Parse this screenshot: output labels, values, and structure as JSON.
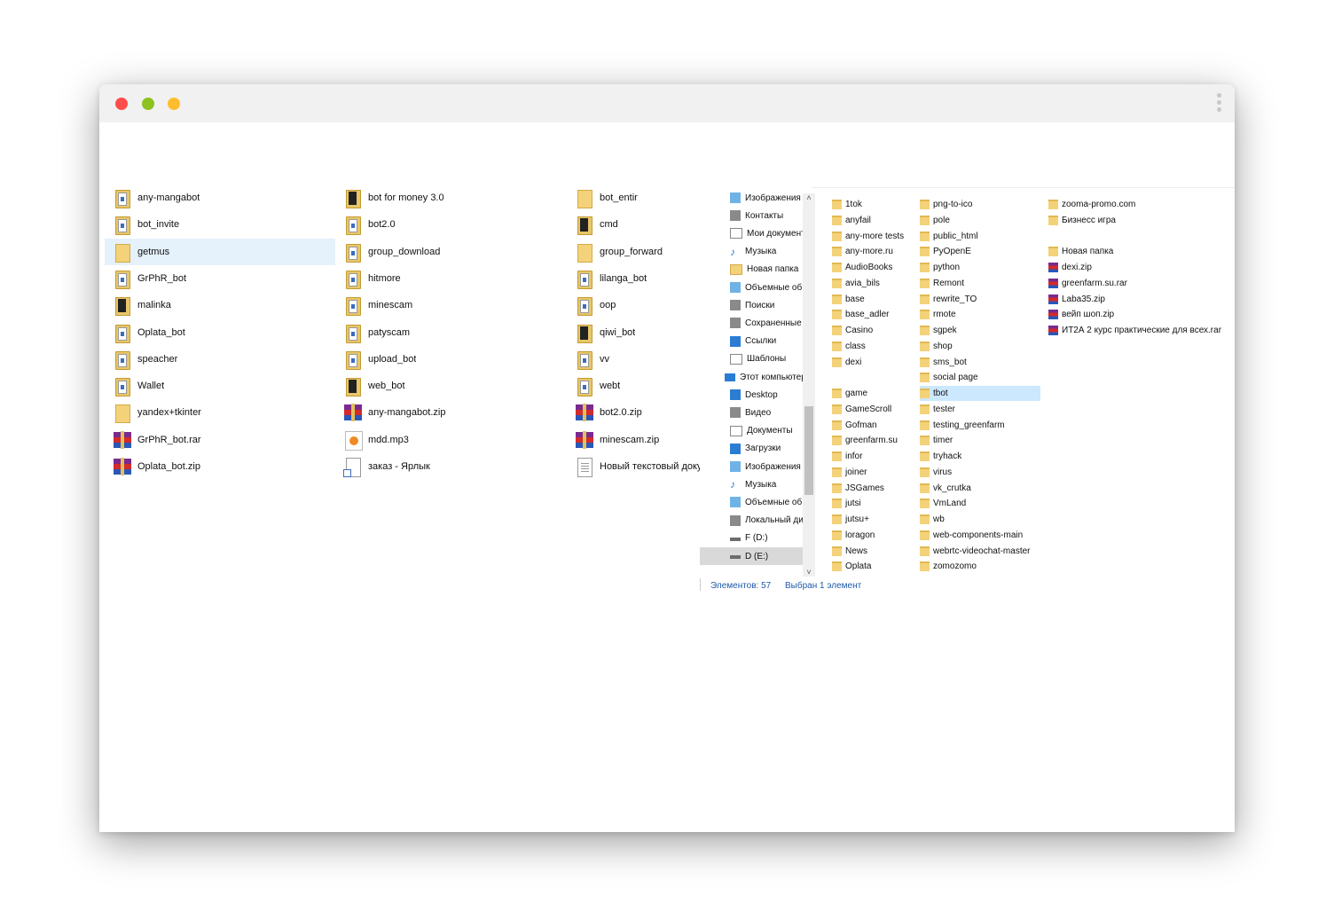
{
  "window": {
    "controls": [
      "close",
      "minimize",
      "maximize"
    ]
  },
  "left_view": {
    "columns": [
      [
        {
          "name": "any-mangabot",
          "icon": "folder-doc-icon"
        },
        {
          "name": "bot_invite",
          "icon": "folder-doc-icon"
        },
        {
          "name": "getmus",
          "icon": "folder-icon",
          "selected": true
        },
        {
          "name": "GrPhR_bot",
          "icon": "folder-doc-icon"
        },
        {
          "name": "malinka",
          "icon": "folder-dark-icon"
        },
        {
          "name": "Oplata_bot",
          "icon": "folder-doc-icon"
        },
        {
          "name": "speacher",
          "icon": "folder-doc-icon"
        },
        {
          "name": "Wallet",
          "icon": "folder-doc-icon"
        },
        {
          "name": "yandex+tkinter",
          "icon": "folder-icon"
        },
        {
          "name": "GrPhR_bot.rar",
          "icon": "archive-icon"
        },
        {
          "name": "Oplata_bot.zip",
          "icon": "archive-icon"
        }
      ],
      [
        {
          "name": "bot for money 3.0",
          "icon": "folder-dark-icon"
        },
        {
          "name": "bot2.0",
          "icon": "folder-doc-icon"
        },
        {
          "name": "group_download",
          "icon": "folder-doc-icon"
        },
        {
          "name": "hitmore",
          "icon": "folder-doc-icon"
        },
        {
          "name": "minescam",
          "icon": "folder-doc-icon"
        },
        {
          "name": "patyscam",
          "icon": "folder-doc-icon"
        },
        {
          "name": "upload_bot",
          "icon": "folder-doc-icon"
        },
        {
          "name": "web_bot",
          "icon": "folder-dark-icon"
        },
        {
          "name": "any-mangabot.zip",
          "icon": "archive-icon"
        },
        {
          "name": "mdd.mp3",
          "icon": "audio-icon"
        },
        {
          "name": "заказ - Ярлык",
          "icon": "shortcut-icon"
        }
      ],
      [
        {
          "name": "bot_entir",
          "icon": "folder-icon"
        },
        {
          "name": "cmd",
          "icon": "folder-dark-icon"
        },
        {
          "name": "group_forward",
          "icon": "folder-icon"
        },
        {
          "name": "lilanga_bot",
          "icon": "folder-doc-icon"
        },
        {
          "name": "oop",
          "icon": "folder-doc-icon"
        },
        {
          "name": "qiwi_bot",
          "icon": "folder-dark-icon"
        },
        {
          "name": "vv",
          "icon": "folder-doc-icon"
        },
        {
          "name": "webt",
          "icon": "folder-doc-icon"
        },
        {
          "name": "bot2.0.zip",
          "icon": "archive-icon"
        },
        {
          "name": "minescam.zip",
          "icon": "archive-icon"
        },
        {
          "name": "Новый текстовый докуме",
          "icon": "text-file-icon"
        }
      ]
    ]
  },
  "nav_pane": {
    "items": [
      {
        "label": "Изображения",
        "icon": "pictures-icon"
      },
      {
        "label": "Контакты",
        "icon": "contacts-icon"
      },
      {
        "label": "Мои документ",
        "icon": "documents-icon"
      },
      {
        "label": "Музыка",
        "icon": "music-icon"
      },
      {
        "label": "Новая папка",
        "icon": "folder-icon"
      },
      {
        "label": "Объемные об",
        "icon": "3d-objects-icon"
      },
      {
        "label": "Поиски",
        "icon": "search-icon"
      },
      {
        "label": "Сохраненные",
        "icon": "saved-games-icon"
      },
      {
        "label": "Ссылки",
        "icon": "links-icon"
      },
      {
        "label": "Шаблоны",
        "icon": "templates-icon"
      },
      {
        "label": "Этот компьютер",
        "icon": "this-pc-icon"
      },
      {
        "label": "Desktop",
        "icon": "desktop-icon"
      },
      {
        "label": "Видео",
        "icon": "video-icon"
      },
      {
        "label": "Документы",
        "icon": "documents-icon"
      },
      {
        "label": "Загрузки",
        "icon": "downloads-icon"
      },
      {
        "label": "Изображения",
        "icon": "pictures-icon"
      },
      {
        "label": "Музыка",
        "icon": "music-icon"
      },
      {
        "label": "Объемные об",
        "icon": "3d-objects-icon"
      },
      {
        "label": "Локальный ди",
        "icon": "local-disk-icon"
      },
      {
        "label": "F (D:)",
        "icon": "drive-icon"
      },
      {
        "label": "D (E:)",
        "icon": "drive-icon",
        "selected": true
      }
    ],
    "scroll_up": "˄",
    "scroll_down": "˅"
  },
  "file_grid": {
    "columns": [
      [
        "1tok",
        "anyfail",
        "any-more tests",
        "any-more.ru",
        "AudioBooks",
        "avia_bils",
        "base",
        "base_adler",
        "Casino",
        "class",
        "dexi",
        "",
        "game",
        "GameScroll",
        "Gofman",
        "greenfarm.su",
        "infor",
        "joiner",
        "JSGames",
        "jutsi",
        "jutsu+",
        "loragon",
        "News",
        "Oplata"
      ],
      [
        "png-to-ico",
        "pole",
        "public_html",
        "PyOpenE",
        "python",
        "Remont",
        "rewrite_TO",
        "rmote",
        "sgpek",
        "shop",
        "sms_bot",
        "social page",
        "tbot",
        "tester",
        "testing_greenfarm",
        "timer",
        "tryhack",
        "virus",
        "vk_crutka",
        "VmLand",
        "wb",
        "web-components-main",
        "webrtc-videochat-master",
        "zomozomo"
      ],
      [
        {
          "name": "zooma-promo.com",
          "type": "folder"
        },
        {
          "name": "Бизнесс игра",
          "type": "folder"
        },
        {
          "name": "",
          "type": "empty"
        },
        {
          "name": "Новая папка",
          "type": "folder"
        },
        {
          "name": "dexi.zip",
          "type": "archive"
        },
        {
          "name": "greenfarm.su.rar",
          "type": "archive"
        },
        {
          "name": "Laba35.zip",
          "type": "archive"
        },
        {
          "name": "вейп шоп.zip",
          "type": "archive"
        },
        {
          "name": "ИТ2А 2 курс практические для всех.rar",
          "type": "archive"
        }
      ]
    ],
    "selected": "tbot"
  },
  "status_bar": {
    "count": "Элементов: 57",
    "selection": "Выбран 1 элемент"
  }
}
